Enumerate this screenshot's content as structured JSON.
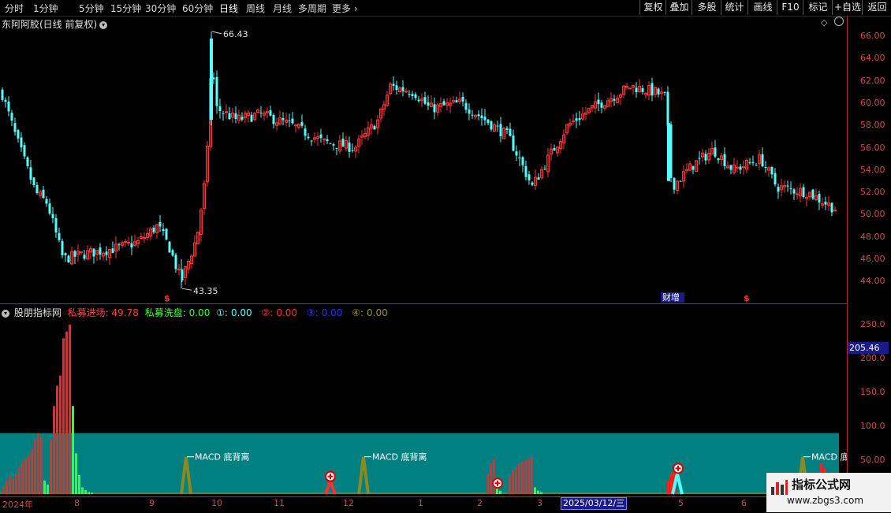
{
  "toolbar": {
    "tabs": [
      "分时",
      "1分钟",
      "5分钟",
      "15分钟",
      "30分钟",
      "60分钟",
      "日线",
      "周线",
      "月线",
      "多周期",
      "更多"
    ],
    "active_tab": "日线",
    "right_buttons": [
      "复权",
      "叠加",
      "多股",
      "统计",
      "画线",
      "F10",
      "标记",
      "+自选",
      "返回"
    ]
  },
  "stock": {
    "title": "东阿阿胶(日线 前复权)"
  },
  "price_axis": [
    "66.00",
    "64.00",
    "62.00",
    "60.00",
    "58.00",
    "56.00",
    "54.00",
    "52.00",
    "50.00",
    "48.00",
    "46.00",
    "44.00"
  ],
  "price_annotations": {
    "high": "66.43",
    "low": "43.35"
  },
  "markers": {
    "s1": "$",
    "s2": "$",
    "caizeng": "财增"
  },
  "indicator": {
    "name": "股朋指标网",
    "v1_label": "私募进场:",
    "v1": "49.78",
    "v2_label": "私募洗盘:",
    "v2": "0.00",
    "v3": "0.00",
    "v4": "0.00",
    "v5": "0.00",
    "v6": "0.00",
    "axis": [
      "250.0",
      "200.0",
      "150.0",
      "100.0",
      "50.00"
    ],
    "current_value": "205.46",
    "macd_label": "MACD 底背离"
  },
  "x_axis": [
    "2024年",
    "8",
    "9",
    "10",
    "11",
    "12",
    "1",
    "2",
    "3",
    "2025/03/12/三",
    "5",
    "6"
  ],
  "watermark": {
    "title": "指标公式网",
    "url": "www.zbgs3.com"
  },
  "colors": {
    "up": "#ff3232",
    "down": "#54ffff",
    "volume_up": "#ff2020",
    "volume_down": "#33ff33",
    "band": "#008080"
  }
}
